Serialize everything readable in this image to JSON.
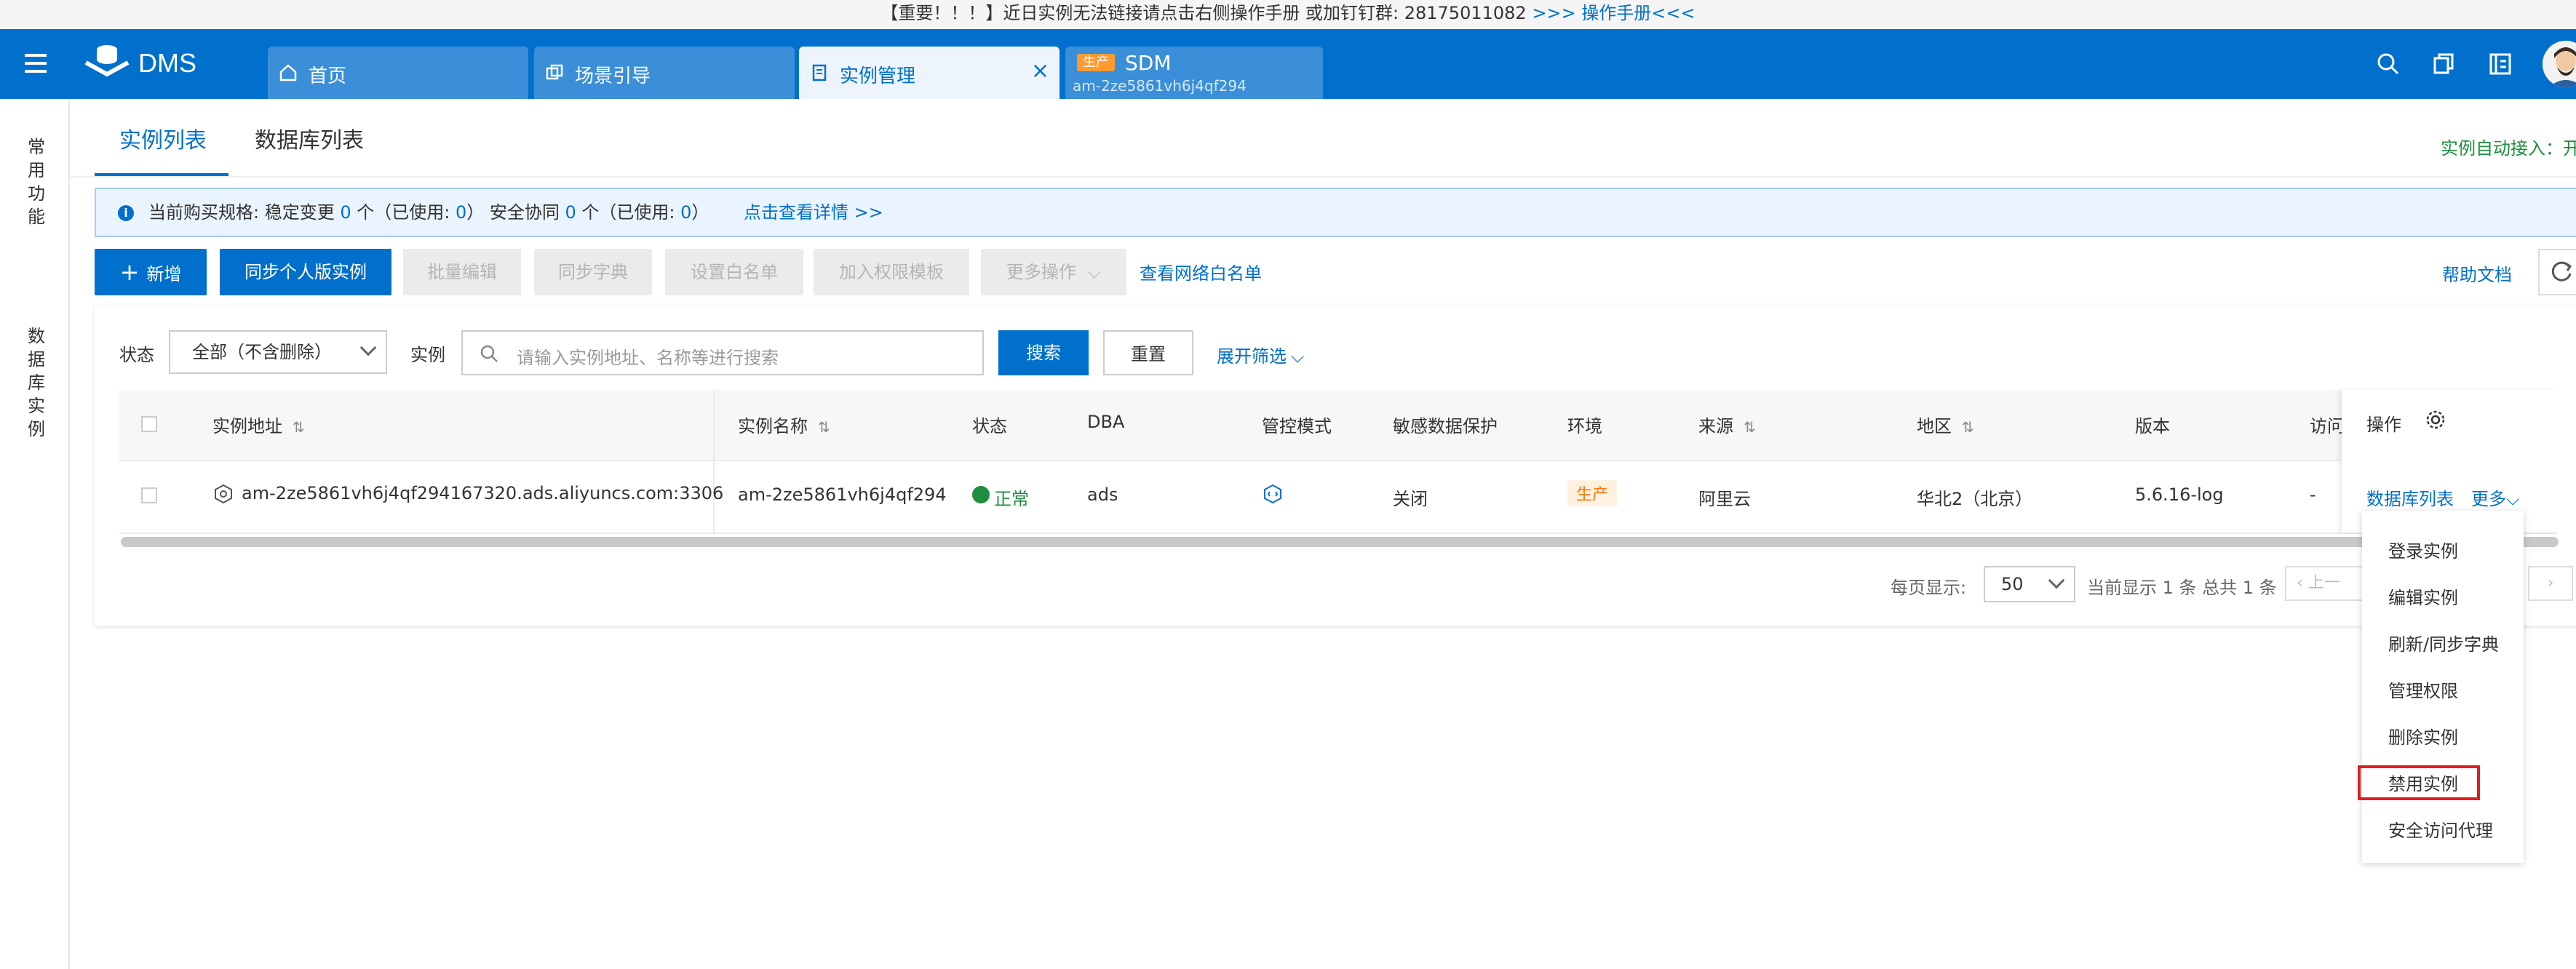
{
  "notice": {
    "text": "【重要！！！】近日实例无法链接请点击右侧操作手册 或加钉钉群: 28175011082 ",
    "link": ">>> 操作手册<<<"
  },
  "header": {
    "logo_text": "DMS",
    "tabs": [
      {
        "label": "首页",
        "icon": "home-icon"
      },
      {
        "label": "场景引导",
        "icon": "guide-icon"
      },
      {
        "label": "实例管理",
        "icon": "instance-icon",
        "active": true
      },
      {
        "label": "SDM",
        "badge": "生产",
        "sub": "am-2ze5861vh6j4qf294"
      }
    ],
    "icons": [
      "search-icon",
      "copy-icon",
      "layout-icon",
      "avatar"
    ]
  },
  "rail": {
    "items": [
      "常用功能",
      "数据库实例"
    ]
  },
  "content_tabs": {
    "tabs": [
      "实例列表",
      "数据库列表"
    ],
    "active": "实例列表",
    "auto_access": "实例自动接入：开"
  },
  "banner": {
    "prefix": "当前购买规格:  稳定变更 ",
    "stable_count": "0",
    "mid1": " 个（已使用: ",
    "stable_used": "0",
    "mid2": "）   安全协同 ",
    "secure_count": "0",
    "mid3": " 个（已使用: ",
    "secure_used": "0",
    "suffix": "）",
    "detail_link": "点击查看详情 >>"
  },
  "toolbar": {
    "add": "新增",
    "sync": "同步个人版实例",
    "batch_edit": "批量编辑",
    "sync_dict": "同步字典",
    "whitelist": "设置白名单",
    "add_perm": "加入权限模板",
    "more_ops": "更多操作",
    "view_whitelist": "查看网络白名单",
    "help": "帮助文档"
  },
  "filters": {
    "status_label": "状态",
    "status_value": "全部（不含删除）",
    "instance_label": "实例",
    "search_placeholder": "请输入实例地址、名称等进行搜索",
    "search_btn": "搜索",
    "reset_btn": "重置",
    "expand": "展开筛选"
  },
  "table": {
    "headers": [
      "实例地址",
      "实例名称",
      "状态",
      "DBA",
      "管控模式",
      "敏感数据保护",
      "环境",
      "来源",
      "地区",
      "版本",
      "访问",
      "操作"
    ],
    "rows": [
      {
        "address": "am-2ze5861vh6j4qf294167320.ads.aliyuncs.com:3306",
        "name": "am-2ze5861vh6j4qf294",
        "status": "正常",
        "dba": "ads",
        "control_mode": "control-mode-icon",
        "sensitive": "关闭",
        "env": "生产",
        "source": "阿里云",
        "region": "华北2（北京）",
        "version": "5.6.16-log",
        "access": "-",
        "op_db_list": "数据库列表",
        "op_more": "更多"
      }
    ]
  },
  "pagination": {
    "per_page_label": "每页显示:",
    "per_page": "50",
    "summary": "当前显示 1 条 总共 1 条",
    "prev": "上一"
  },
  "more_menu": {
    "items": [
      "登录实例",
      "编辑实例",
      "刷新/同步字典",
      "管理权限",
      "删除实例",
      "禁用实例",
      "安全访问代理"
    ],
    "highlighted": "禁用实例"
  },
  "colors": {
    "brand": "#0070cc",
    "success": "#1e8e3e",
    "warning": "#f47a10",
    "highlight": "#e02020"
  }
}
